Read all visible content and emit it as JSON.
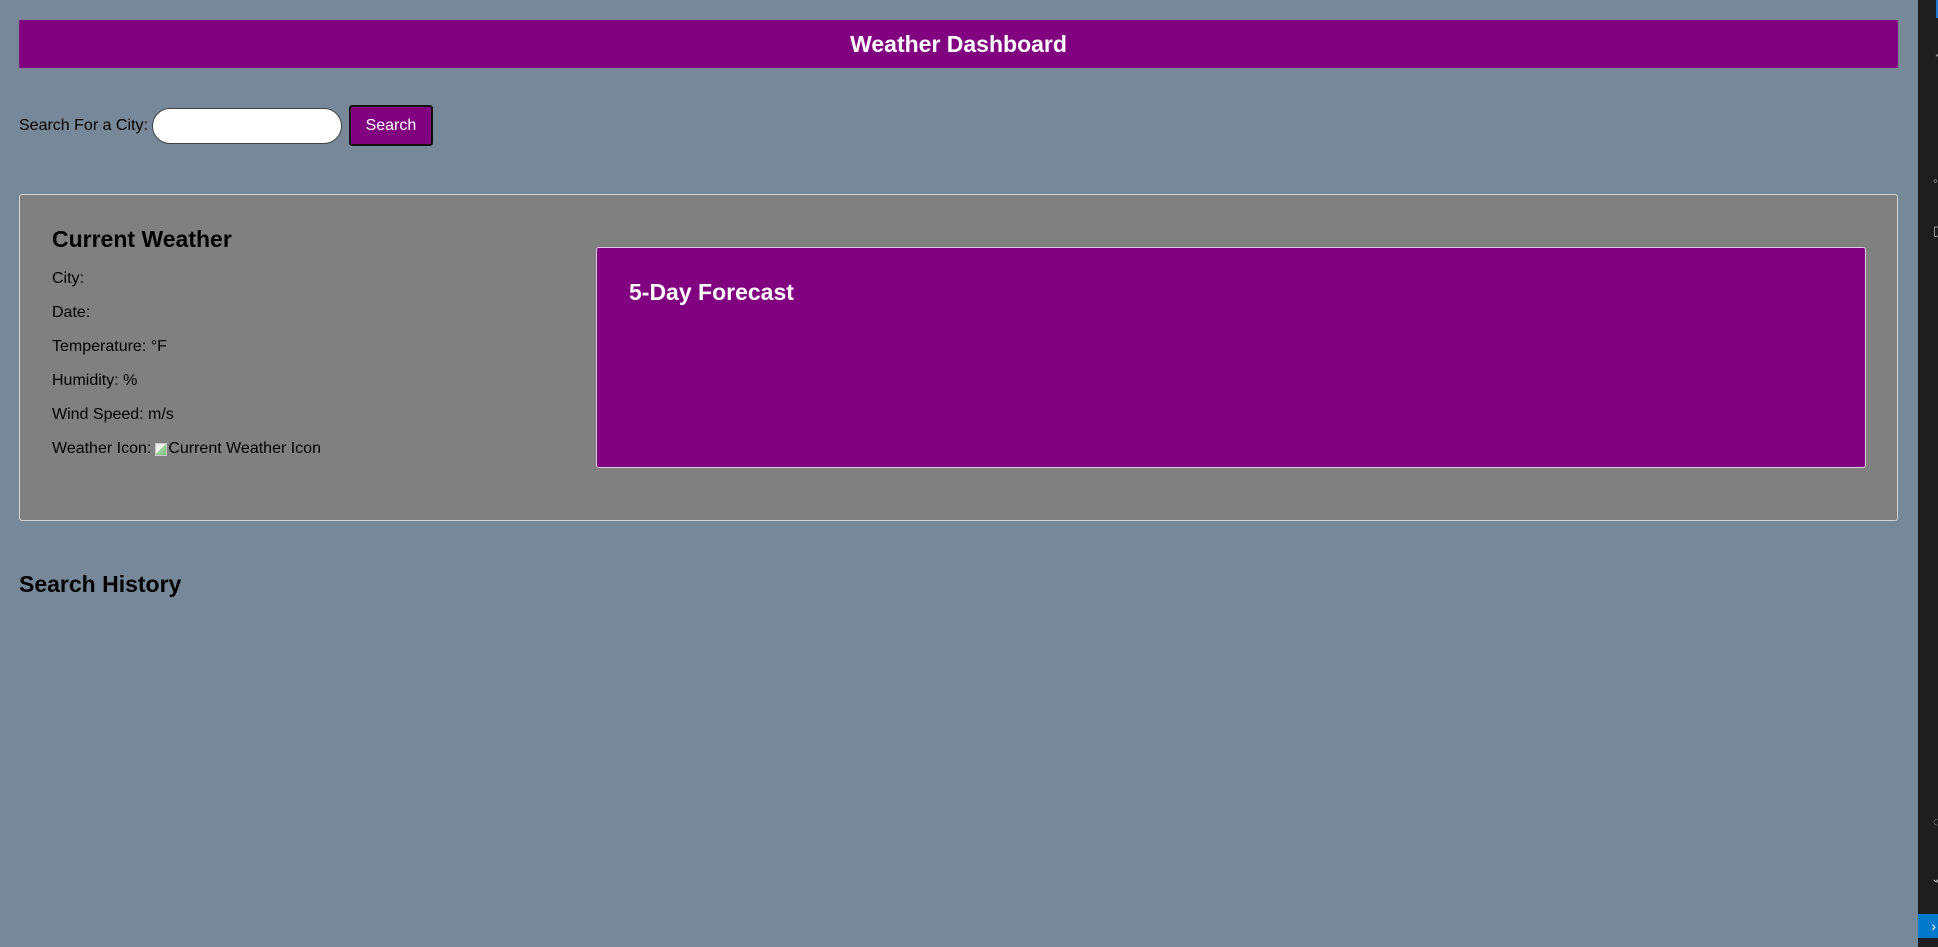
{
  "header": {
    "title": "Weather Dashboard"
  },
  "search": {
    "label": "Search For a City:",
    "input_value": "",
    "placeholder": "",
    "button_label": "Search"
  },
  "current_weather": {
    "title": "Current Weather",
    "city_label": "City:",
    "date_label": "Date:",
    "temperature_label": "Temperature: °F",
    "humidity_label": "Humidity: %",
    "wind_speed_label": "Wind Speed: m/s",
    "weather_icon_label": "Weather Icon:",
    "weather_icon_alt": "Current Weather Icon"
  },
  "forecast": {
    "title": "5-Day Forecast"
  },
  "history": {
    "title": "Search History"
  },
  "colors": {
    "page_background": "#778899",
    "accent": "#800080",
    "panel_background": "#808080"
  },
  "icons": {
    "broken_image": "broken-image-icon"
  }
}
